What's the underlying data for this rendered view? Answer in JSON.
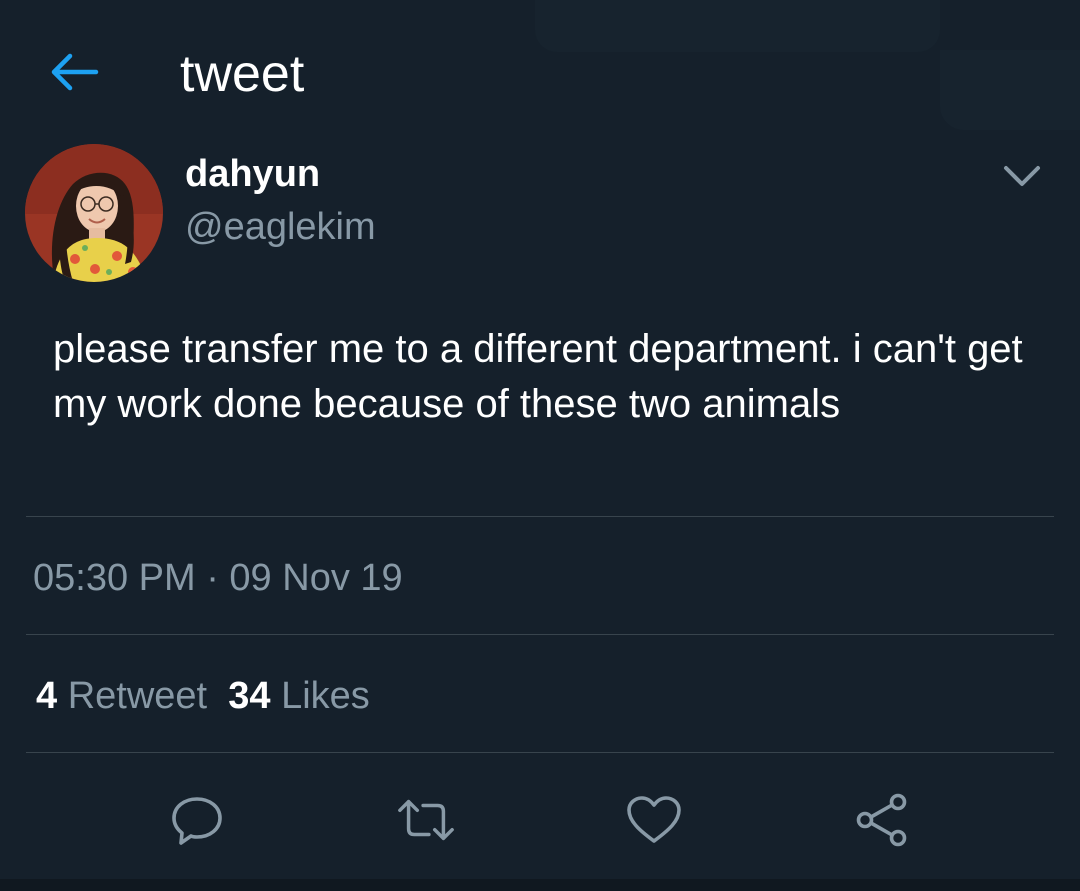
{
  "header": {
    "title": "tweet",
    "back_icon": "arrow-left-icon"
  },
  "colors": {
    "background": "#15202b",
    "accent": "#1da1f2",
    "muted_text": "#8899a6",
    "divider": "#38444d"
  },
  "tweet": {
    "author_name": "dahyun",
    "author_handle": "@eaglekim",
    "menu_icon": "chevron-down-icon",
    "text": "please transfer me to a different department. i can't get my work done because of these two animals",
    "timestamp": "05:30 PM · 09 Nov 19",
    "retweet_count": "4",
    "retweet_label": "Retweet",
    "like_count": "34",
    "like_label": "Likes"
  },
  "actions": [
    {
      "icon": "reply-icon"
    },
    {
      "icon": "retweet-icon"
    },
    {
      "icon": "heart-icon"
    },
    {
      "icon": "share-icon"
    }
  ]
}
